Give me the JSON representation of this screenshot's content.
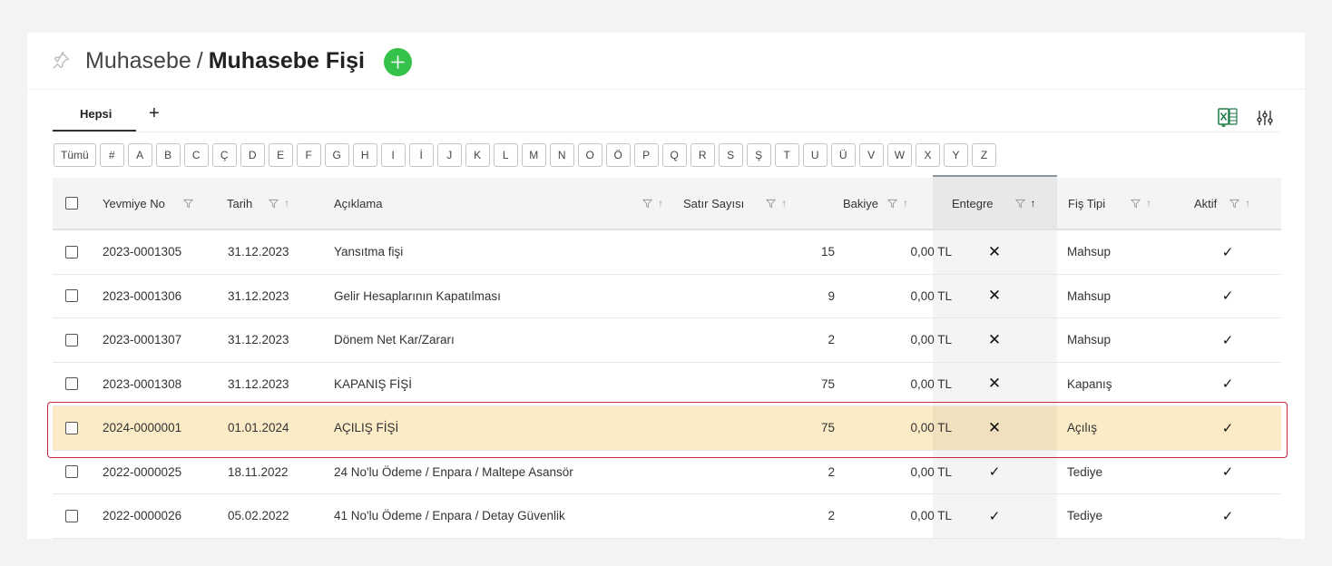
{
  "header": {
    "breadcrumb_parent": "Muhasebe",
    "separator": "/",
    "title": "Muhasebe Fişi",
    "add_button_color": "#35c24a"
  },
  "tabs": {
    "items": [
      {
        "label": "Hepsi",
        "active": true
      }
    ],
    "add_label": "+"
  },
  "toolbar": {
    "excel_icon": "excel-export-icon",
    "settings_icon": "column-settings-icon"
  },
  "letters": [
    "Tümü",
    "#",
    "A",
    "B",
    "C",
    "Ç",
    "D",
    "E",
    "F",
    "G",
    "H",
    "I",
    "İ",
    "J",
    "K",
    "L",
    "M",
    "N",
    "O",
    "Ö",
    "P",
    "Q",
    "R",
    "S",
    "Ş",
    "T",
    "U",
    "Ü",
    "V",
    "W",
    "X",
    "Y",
    "Z"
  ],
  "table": {
    "columns": {
      "yevmiye_no": "Yevmiye No",
      "tarih": "Tarih",
      "aciklama": "Açıklama",
      "satir_sayisi": "Satır Sayısı",
      "bakiye": "Bakiye",
      "entegre": "Entegre",
      "fis_tipi": "Fiş Tipi",
      "aktif": "Aktif"
    },
    "sorted_column": "entegre",
    "rows": [
      {
        "yevmiye_no": "2023-0001305",
        "tarih": "31.12.2023",
        "aciklama": "Yansıtma fişi",
        "satir_sayisi": "15",
        "bakiye": "0,00 TL",
        "entegre": "✕",
        "fis_tipi": "Mahsup",
        "aktif": "✓",
        "selected": false
      },
      {
        "yevmiye_no": "2023-0001306",
        "tarih": "31.12.2023",
        "aciklama": "Gelir Hesaplarının Kapatılması",
        "satir_sayisi": "9",
        "bakiye": "0,00 TL",
        "entegre": "✕",
        "fis_tipi": "Mahsup",
        "aktif": "✓",
        "selected": false
      },
      {
        "yevmiye_no": "2023-0001307",
        "tarih": "31.12.2023",
        "aciklama": "Dönem Net Kar/Zararı",
        "satir_sayisi": "2",
        "bakiye": "0,00 TL",
        "entegre": "✕",
        "fis_tipi": "Mahsup",
        "aktif": "✓",
        "selected": false
      },
      {
        "yevmiye_no": "2023-0001308",
        "tarih": "31.12.2023",
        "aciklama": "KAPANIŞ FİŞİ",
        "satir_sayisi": "75",
        "bakiye": "0,00 TL",
        "entegre": "✕",
        "fis_tipi": "Kapanış",
        "aktif": "✓",
        "selected": false
      },
      {
        "yevmiye_no": "2024-0000001",
        "tarih": "01.01.2024",
        "aciklama": "AÇILIŞ FİŞİ",
        "satir_sayisi": "75",
        "bakiye": "0,00 TL",
        "entegre": "✕",
        "fis_tipi": "Açılış",
        "aktif": "✓",
        "selected": true
      },
      {
        "yevmiye_no": "2022-0000025",
        "tarih": "18.11.2022",
        "aciklama": "24 No'lu Ödeme / Enpara / Maltepe Asansör",
        "satir_sayisi": "2",
        "bakiye": "0,00 TL",
        "entegre": "✓",
        "fis_tipi": "Tediye",
        "aktif": "✓",
        "selected": false
      },
      {
        "yevmiye_no": "2022-0000026",
        "tarih": "05.02.2022",
        "aciklama": "41 No'lu Ödeme / Enpara / Detay Güvenlik",
        "satir_sayisi": "2",
        "bakiye": "0,00 TL",
        "entegre": "✓",
        "fis_tipi": "Tediye",
        "aktif": "✓",
        "selected": false
      }
    ]
  },
  "colors": {
    "selected_row": "#fbebc6",
    "highlight_border": "#c92a3a"
  }
}
